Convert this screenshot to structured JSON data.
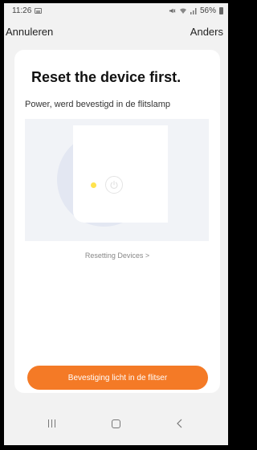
{
  "status": {
    "time": "11:26",
    "right_text": "56%"
  },
  "nav": {
    "cancel_label": "Annuleren",
    "other_label": "Anders"
  },
  "card": {
    "title": "Reset the device first.",
    "subtitle": "Power, werd bevestigd in de flitslamp",
    "link": "Resetting Devices >",
    "button": "Bevestiging licht in de flitser"
  },
  "colors": {
    "accent": "#f47a26",
    "led": "#ffe34d",
    "card_bg": "#ffffff",
    "screen_bg": "#f2f2f2",
    "illustration_bg": "#f1f3f7"
  },
  "icons": {
    "status_left": "image-notification-icon",
    "status_right": [
      "mute-icon",
      "wifi-icon",
      "signal-icon",
      "battery-icon"
    ],
    "device": "power-icon",
    "system_nav": [
      "recent-apps-icon",
      "home-icon",
      "back-icon"
    ]
  }
}
